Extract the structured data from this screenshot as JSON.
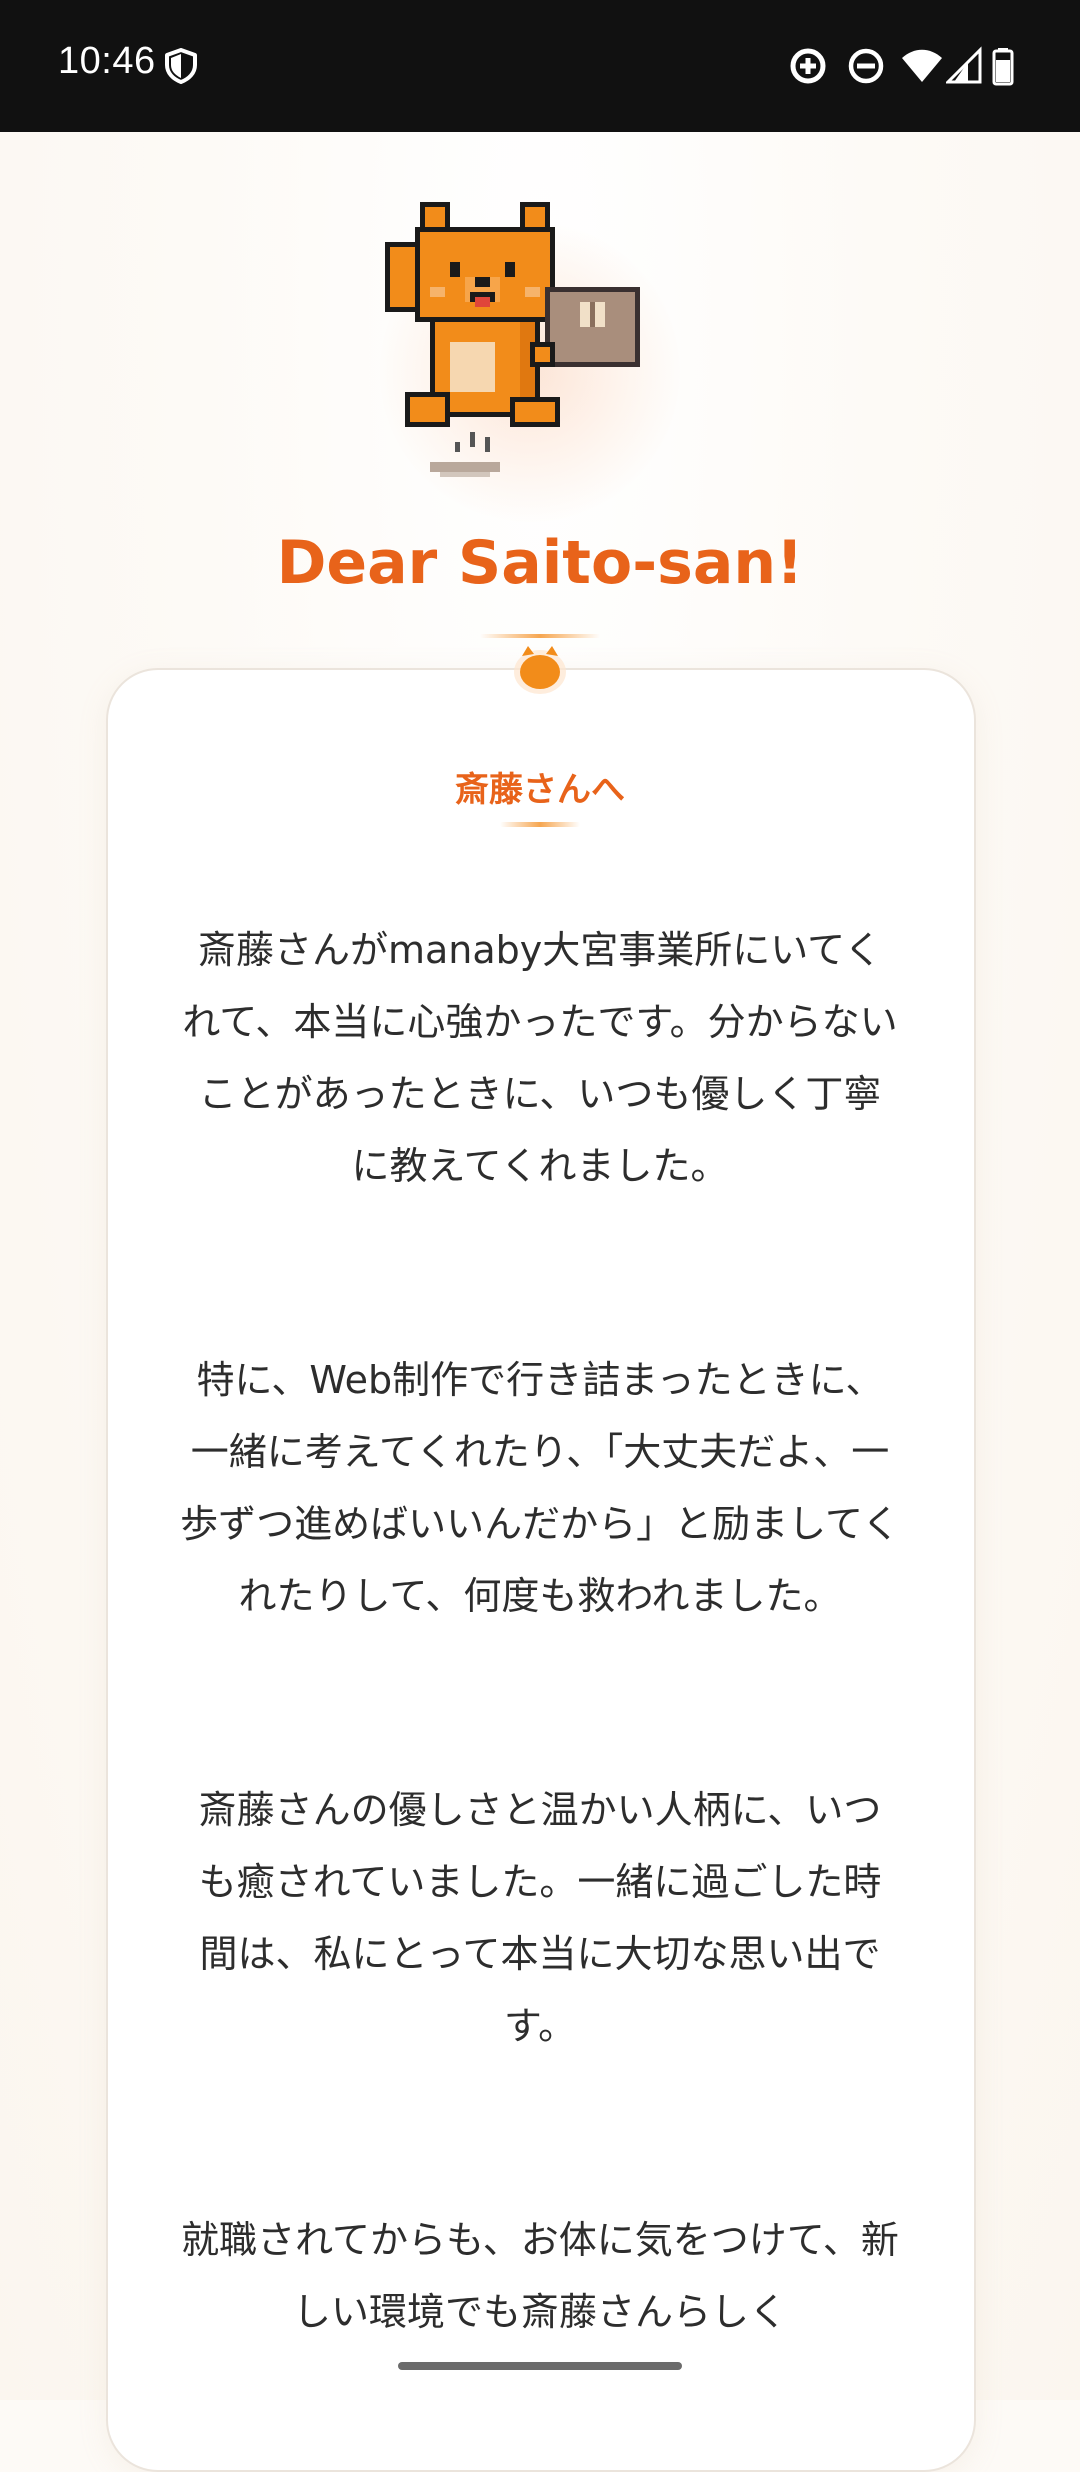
{
  "status_bar": {
    "time": "10:46",
    "icons": [
      "shield-icon",
      "data-saver-icon",
      "do-not-disturb-icon",
      "wifi-icon",
      "signal-icon",
      "battery-icon"
    ]
  },
  "hero": {
    "mascot": "pixel-art-orange-dog-mascot-holding-box",
    "heading": "Dear Saito-san!"
  },
  "letter": {
    "title": "斎藤さんへ",
    "paragraphs": [
      "斎藤さんがmanaby大宮事業所にいてくれて、本当に心強かったです。分からないことがあったときに、いつも優しく丁寧に教えてくれました。",
      "特に、Web制作で行き詰まったときに、一緒に考えてくれたり、「大丈夫だよ、一歩ずつ進めばいいんだから」と励ましてくれたりして、何度も救われました。",
      "斎藤さんの優しさと温かい人柄に、いつも癒されていました。一緒に過ごした時間は、私にとって本当に大切な思い出です。",
      "就職されてからも、お体に気をつけて、新しい環境でも斎藤さんらしく"
    ]
  },
  "colors": {
    "accent": "#e8631a",
    "status_bar_bg": "#111111",
    "page_bg": "#fdfaf6",
    "text": "#2d2d2d"
  }
}
